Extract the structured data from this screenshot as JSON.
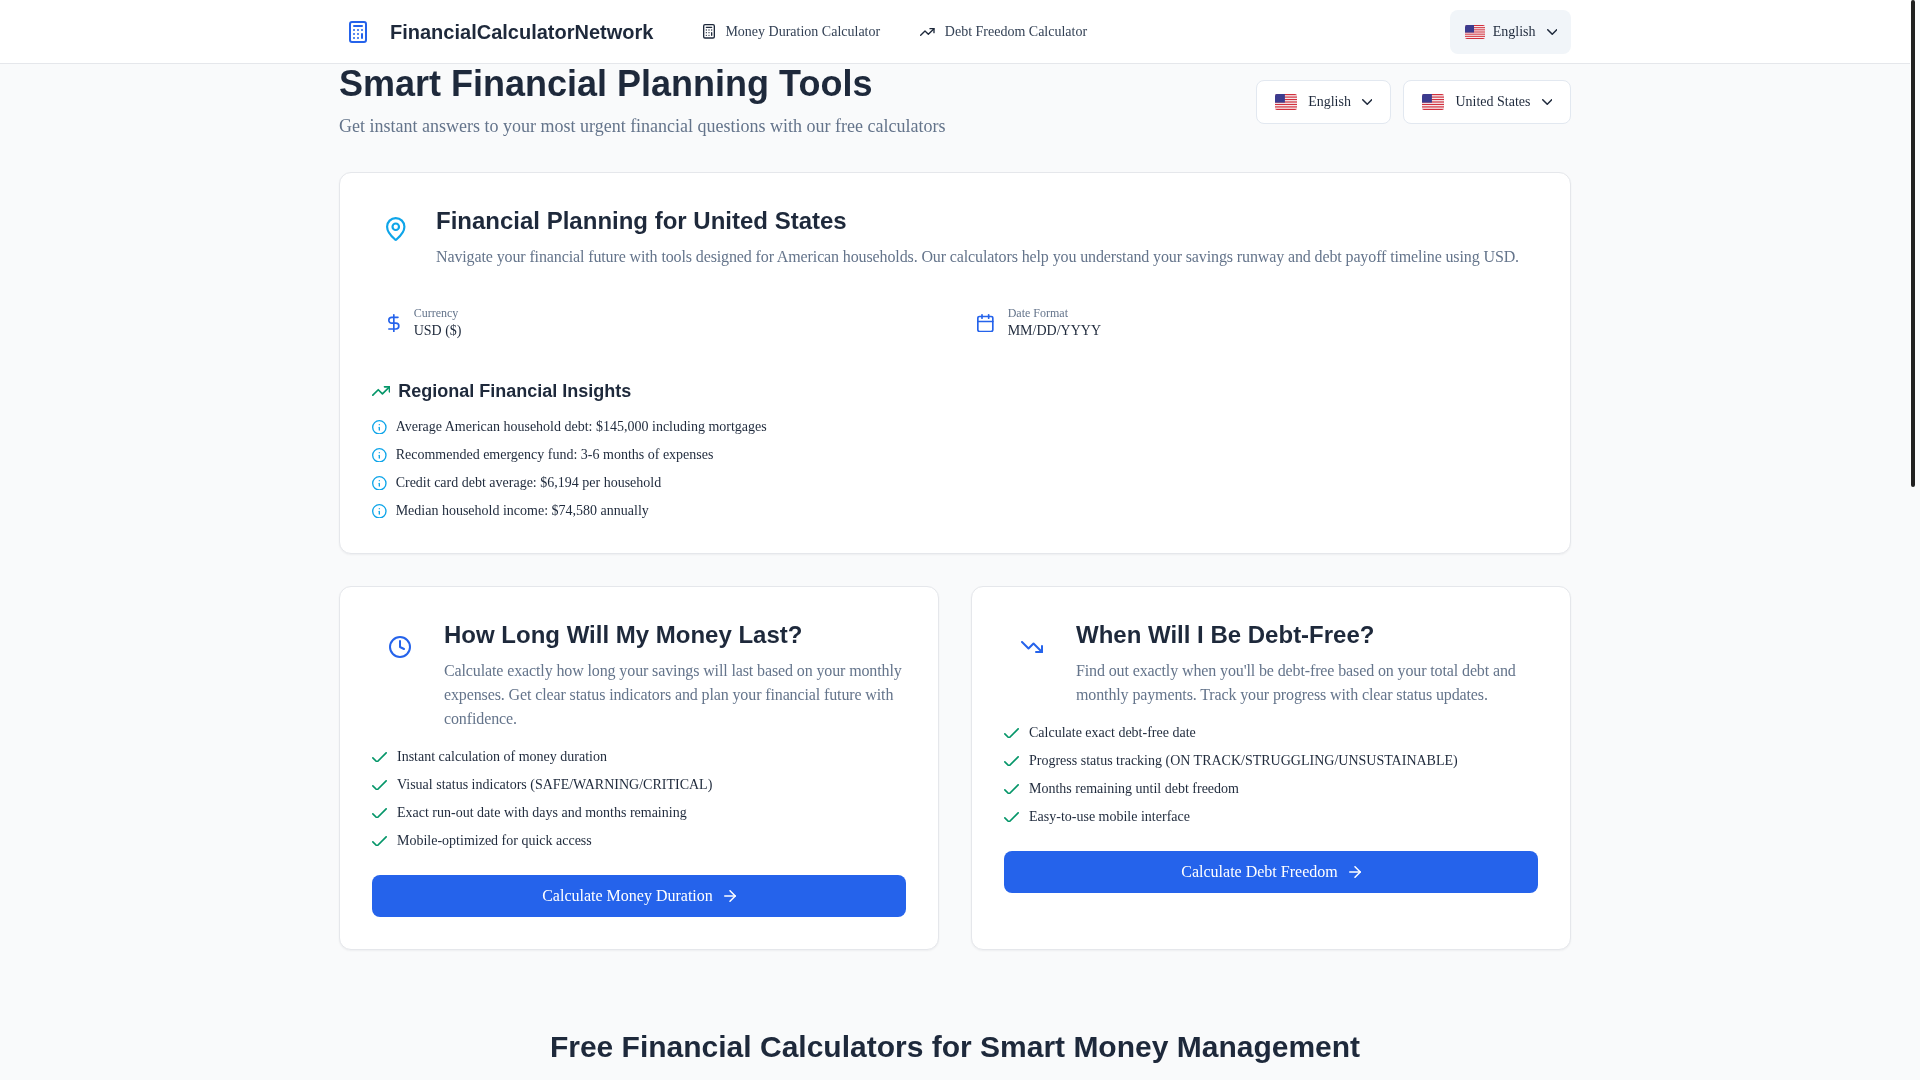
{
  "header": {
    "logo": "FinancialCalculatorNetwork",
    "nav": [
      "Money Duration Calculator",
      "Debt Freedom Calculator"
    ],
    "language": "English"
  },
  "hero": {
    "title": "Smart Financial Planning Tools",
    "subtitle": "Get instant answers to your most urgent financial questions with our free calculators",
    "selectors": [
      "English",
      "United States"
    ]
  },
  "region_card": {
    "title": "Financial Planning for United States",
    "description": "Navigate your financial future with tools designed for American households. Our calculators help you understand your savings runway and debt payoff timeline using USD.",
    "details": [
      {
        "label": "Currency",
        "value": "USD ($)"
      },
      {
        "label": "Date Format",
        "value": "MM/DD/YYYY"
      }
    ],
    "insights": {
      "title": "Regional Financial Insights",
      "items": [
        "Average American household debt: $145,000 including mortgages",
        "Recommended emergency fund: 3-6 months of expenses",
        "Credit card debt average: $6,194 per household",
        "Median household income: $74,580 annually"
      ]
    }
  },
  "calculators": [
    {
      "title": "How Long Will My Money Last?",
      "description": "Calculate exactly how long your savings will last based on your monthly expenses. Get clear status indicators and plan your financial future with confidence.",
      "features": [
        "Instant calculation of money duration",
        "Visual status indicators (SAFE/WARNING/CRITICAL)",
        "Exact run-out date with days and months remaining",
        "Mobile-optimized for quick access"
      ],
      "button": "Calculate Money Duration"
    },
    {
      "title": "When Will I Be Debt-Free?",
      "description": "Find out exactly when you'll be debt-free based on your total debt and monthly payments. Track your progress with clear status updates.",
      "features": [
        "Calculate exact debt-free date",
        "Progress status tracking (ON TRACK/STRUGGLING/UNSUSTAINABLE)",
        "Months remaining until debt freedom",
        "Easy-to-use mobile interface"
      ],
      "button": "Calculate Debt Freedom"
    }
  ],
  "section_title": "Free Financial Calculators for Smart Money Management"
}
